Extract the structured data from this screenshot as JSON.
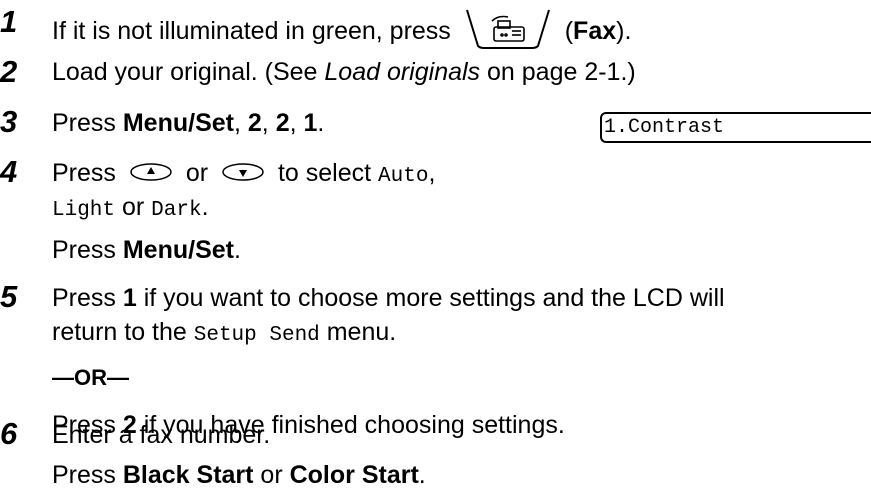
{
  "steps": [
    {
      "number": "1",
      "lines": [
        {
          "t1": "If it is not illuminated in green, press",
          "btn_icon": "fax-machine-icon",
          "t2": " (",
          "b1": "Fax",
          "t3": ")."
        }
      ]
    },
    {
      "number": "2",
      "text_a": "Load your original. (See ",
      "text_italic": "Load originals",
      "text_b": " on page 2-1.)"
    },
    {
      "number": "3",
      "prefix": "Press ",
      "b_menu": "Menu/Set",
      "sep1": ", ",
      "b2": "2",
      "sep2": ", ",
      "b3": "2",
      "sep3": ", ",
      "b4": "1",
      "suffix": ".",
      "lcd_text": "1.Contrast"
    },
    {
      "number": "4",
      "line1_prefix": "Press ",
      "up_icon": "up-arrow-key-icon",
      "or1": " or ",
      "down_icon": "down-arrow-key-icon",
      "line1_suffix": " to select ",
      "opt_auto": "Auto",
      "comma": ",",
      "opt_light": "Light",
      "or2": " or ",
      "opt_dark": "Dark",
      "period": ".",
      "line3_prefix": "Press ",
      "line3_bold": "Menu/Set",
      "line3_suffix": "."
    },
    {
      "number": "5",
      "line1_prefix": "Press ",
      "line1_bold": "1",
      "line1_suffix": " if you want to choose more settings and the LCD will",
      "line2_prefix": "return to the ",
      "line2_mono": "Setup Send",
      "line2_suffix": " menu.",
      "or_text": "—OR—",
      "line4_prefix": "Press ",
      "line4_bold": "2",
      "line4_suffix": " if you have finished choosing settings."
    },
    {
      "number": "6",
      "line1": "Enter a fax number.",
      "line2_prefix": "Press ",
      "line2_b1": "Black Start",
      "line2_or": " or ",
      "line2_b2": "Color Start",
      "line2_suffix": "."
    }
  ]
}
